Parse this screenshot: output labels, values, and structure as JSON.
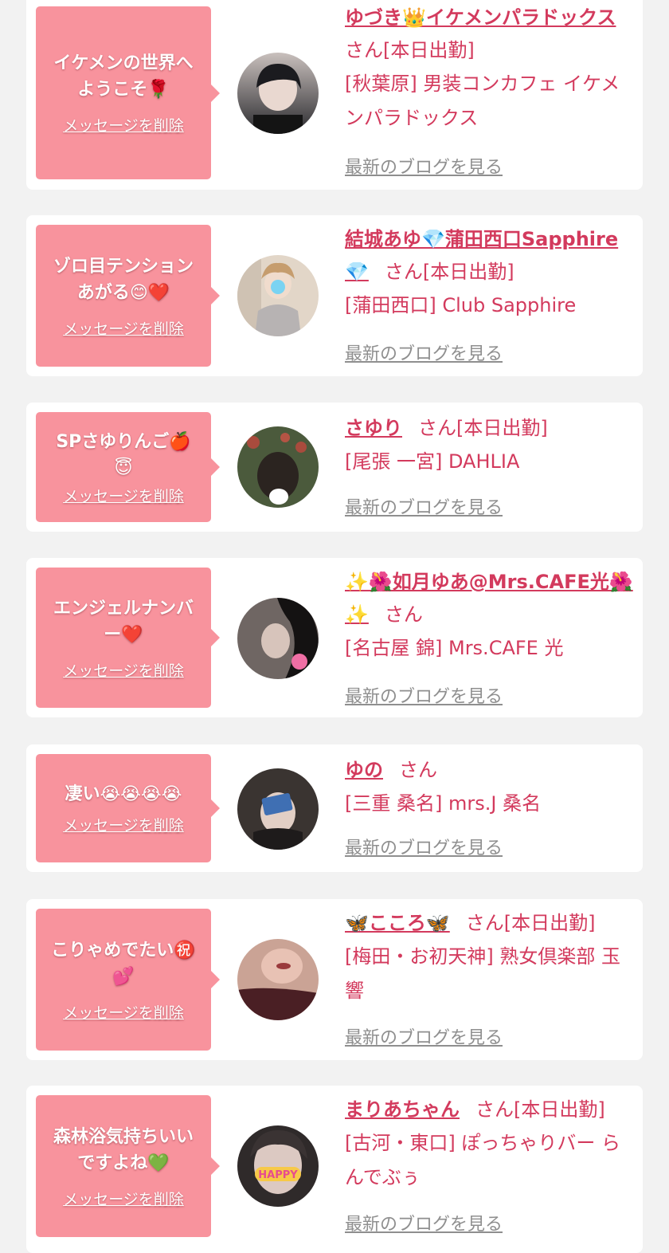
{
  "delete_label": "メッセージを削除",
  "blog_label": "最新のブログを見る",
  "cards": [
    {
      "bubble": "イケメンの世界へ\nようこそ🌹",
      "name": "ゆづき👑イケメンパラドックス",
      "status": "さん[本日出勤]",
      "shop": "[秋葉原] 男装コンカフェ イケメンパラドックス",
      "avatar_colors": [
        "#2a2a2e",
        "#c9c0bd"
      ]
    },
    {
      "bubble": "ゾロ目テンション\nあがる😊❤️",
      "name": "結城あゆ💎蒲田西口Sapphire💎",
      "status": "さん[本日出勤]",
      "shop": "[蒲田西口] Club Sapphire",
      "avatar_colors": [
        "#e8ddd0",
        "#b3a89d"
      ]
    },
    {
      "bubble": "SPさゆりんご🍎\n😇",
      "name": "さゆり",
      "status": "さん[本日出勤]",
      "shop": "[尾張 一宮] DAHLIA",
      "avatar_colors": [
        "#3c3a32",
        "#8a7f6f"
      ]
    },
    {
      "bubble": "エンジェルナンバ\nー❤️",
      "name": "✨🌺如月ゆあ@Mrs.CAFE光🌺✨",
      "status": "さん",
      "shop": "[名古屋 錦] Mrs.CAFE 光",
      "avatar_colors": [
        "#1e1c1c",
        "#6d6462"
      ]
    },
    {
      "bubble": "凄い😭😭😭😭",
      "name": "ゆの",
      "status": "さん",
      "shop": "[三重 桑名] mrs.J 桑名",
      "avatar_colors": [
        "#2f2b29",
        "#a79e8e"
      ]
    },
    {
      "bubble": "こりゃめでたい㊗️\n💕",
      "name": "🦋こころ🦋",
      "status": "さん[本日出勤]",
      "shop": "[梅田・お初天神] 熟女倶楽部 玉響",
      "avatar_colors": [
        "#3b1a1c",
        "#d8aa9a"
      ]
    },
    {
      "bubble": "森林浴気持ちいい\nですよね💚",
      "name": "まりあちゃん",
      "status": "さん[本日出勤]",
      "shop": "[古河・東口] ぽっちゃりバー らんでぶぅ",
      "avatar_colors": [
        "#3d3636",
        "#d9c9c3"
      ]
    }
  ]
}
